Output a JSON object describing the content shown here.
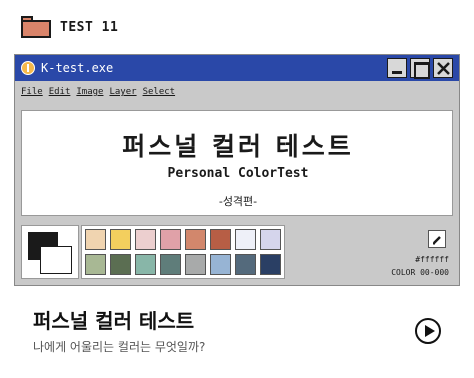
{
  "header": {
    "title": "TEST 11",
    "icon": "folder-icon",
    "icon_color": "#d9846a"
  },
  "window": {
    "title": "K-test.exe",
    "titlebar_color": "#2a48a8",
    "menu": [
      "File",
      "Edit",
      "Image",
      "Layer",
      "Select"
    ],
    "controls": [
      "minimize-icon",
      "maximize-icon",
      "close-icon"
    ]
  },
  "canvas": {
    "korean_title": "퍼스널 컬러 테스트",
    "english_title": "Personal ColorTest",
    "subtitle": "-성격편-"
  },
  "palette": {
    "foreground": "#1a1a1a",
    "background": "#ffffff",
    "swatches_row1": [
      "#f0d4b0",
      "#f3cf5e",
      "#eccfcf",
      "#e0a1a8",
      "#d2876c",
      "#b75e45",
      "#eef0f8",
      "#d5d5ec"
    ],
    "swatches_row2": [
      "#a8b894",
      "#5b6e52",
      "#88b6a8",
      "#5f7d7a",
      "#a8aaaa",
      "#97b4d4",
      "#546a7c",
      "#2a3f64"
    ],
    "hex": "#ffffff",
    "color_code": "COLOR 00-000",
    "tool_icon": "pencil-icon"
  },
  "footer": {
    "title": "퍼스널 컬러 테스트",
    "subtitle": "나에게 어울리는 컬러는 무엇일까?",
    "play_icon": "play-icon"
  }
}
